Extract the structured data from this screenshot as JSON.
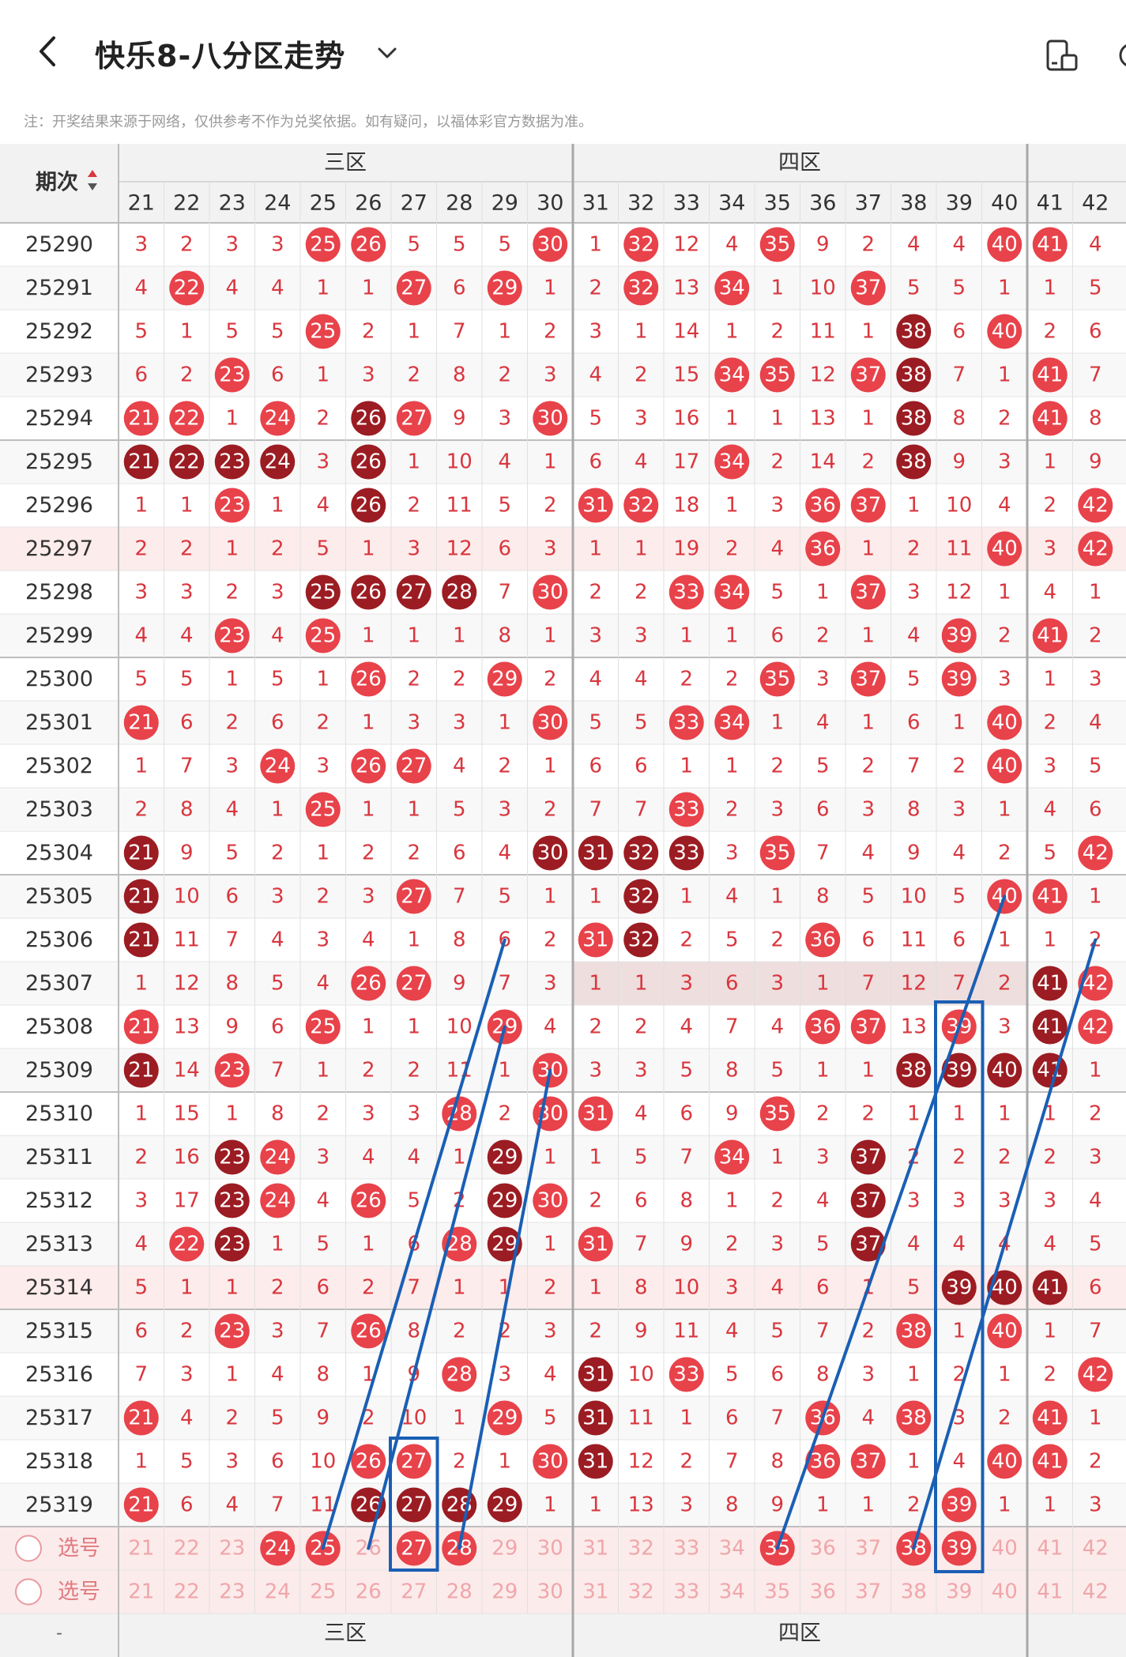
{
  "header": {
    "title": "快乐8-八分区走势",
    "note": "注：开奖结果来源于网络，仅供参考不作为兑奖依据。如有疑问，以福体彩官方数据为准。"
  },
  "table": {
    "period_header": "期次",
    "zones": [
      "三区",
      "四区"
    ],
    "columns": [
      21,
      22,
      23,
      24,
      25,
      26,
      27,
      28,
      29,
      30,
      31,
      32,
      33,
      34,
      35,
      36,
      37,
      38,
      39,
      40,
      41,
      42
    ],
    "select_label": "选号",
    "rows": [
      {
        "period": "25290",
        "cells": [
          3,
          2,
          3,
          3,
          "25r",
          "26r",
          5,
          5,
          5,
          "30r",
          1,
          "32r",
          12,
          4,
          "35r",
          9,
          2,
          4,
          4,
          "40r",
          "41r",
          4
        ]
      },
      {
        "period": "25291",
        "cells": [
          4,
          "22r",
          4,
          4,
          1,
          1,
          "27r",
          6,
          "29r",
          1,
          2,
          "32r",
          13,
          "34r",
          1,
          10,
          "37r",
          5,
          5,
          1,
          1,
          5
        ]
      },
      {
        "period": "25292",
        "cells": [
          5,
          1,
          5,
          5,
          "25r",
          2,
          1,
          7,
          1,
          2,
          3,
          1,
          14,
          1,
          2,
          11,
          1,
          "38d",
          6,
          "40r",
          2,
          6
        ]
      },
      {
        "period": "25293",
        "cells": [
          6,
          2,
          "23r",
          6,
          1,
          3,
          2,
          8,
          2,
          3,
          4,
          2,
          15,
          "34r",
          "35r",
          12,
          "37r",
          "38d",
          7,
          1,
          "41r",
          7
        ]
      },
      {
        "period": "25294",
        "cells": [
          "21r",
          "22r",
          1,
          "24r",
          2,
          "26d",
          "27r",
          9,
          3,
          "30r",
          5,
          3,
          16,
          1,
          1,
          13,
          1,
          "38d",
          8,
          2,
          "41r",
          8
        ]
      },
      {
        "period": "25295",
        "cells": [
          "21d",
          "22d",
          "23d",
          "24d",
          3,
          "26d",
          1,
          10,
          4,
          1,
          6,
          4,
          17,
          "34r",
          2,
          14,
          2,
          "38d",
          9,
          3,
          1,
          9
        ]
      },
      {
        "period": "25296",
        "cells": [
          1,
          1,
          "23r",
          1,
          4,
          "26d",
          2,
          11,
          5,
          2,
          "31r",
          "32r",
          18,
          1,
          3,
          "36r",
          "37r",
          1,
          10,
          4,
          2,
          "42r"
        ]
      },
      {
        "period": "25297",
        "cells": [
          2,
          2,
          1,
          2,
          5,
          1,
          3,
          12,
          6,
          3,
          1,
          1,
          19,
          2,
          4,
          "36r",
          1,
          2,
          11,
          "40r",
          3,
          "42r"
        ]
      },
      {
        "period": "25298",
        "cells": [
          3,
          3,
          2,
          3,
          "25d",
          "26d",
          "27d",
          "28d",
          7,
          "30r",
          2,
          2,
          "33r",
          "34r",
          5,
          1,
          "37r",
          3,
          12,
          1,
          4,
          1
        ]
      },
      {
        "period": "25299",
        "cells": [
          4,
          4,
          "23r",
          4,
          "25r",
          1,
          1,
          1,
          8,
          1,
          3,
          3,
          1,
          1,
          6,
          2,
          1,
          4,
          "39r",
          2,
          "41r",
          2
        ]
      },
      {
        "period": "25300",
        "cells": [
          5,
          5,
          1,
          5,
          1,
          "26r",
          2,
          2,
          "29r",
          2,
          4,
          4,
          2,
          2,
          "35r",
          3,
          "37r",
          5,
          "39r",
          3,
          1,
          3
        ]
      },
      {
        "period": "25301",
        "cells": [
          "21r",
          6,
          2,
          6,
          2,
          1,
          3,
          3,
          1,
          "30r",
          5,
          5,
          "33r",
          "34r",
          1,
          4,
          1,
          6,
          1,
          "40r",
          2,
          4
        ]
      },
      {
        "period": "25302",
        "cells": [
          1,
          7,
          3,
          "24r",
          3,
          "26r",
          "27r",
          4,
          2,
          1,
          6,
          6,
          1,
          1,
          2,
          5,
          2,
          7,
          2,
          "40r",
          3,
          5
        ]
      },
      {
        "period": "25303",
        "cells": [
          2,
          8,
          4,
          1,
          "25r",
          1,
          1,
          5,
          3,
          2,
          7,
          7,
          "33r",
          2,
          3,
          6,
          3,
          8,
          3,
          1,
          4,
          6
        ]
      },
      {
        "period": "25304",
        "cells": [
          "21d",
          9,
          5,
          2,
          1,
          2,
          2,
          6,
          4,
          "30d",
          "31d",
          "32d",
          "33d",
          3,
          "35r",
          7,
          4,
          9,
          4,
          2,
          5,
          "42r"
        ]
      },
      {
        "period": "25305",
        "cells": [
          "21d",
          10,
          6,
          3,
          2,
          3,
          "27r",
          7,
          5,
          1,
          1,
          "32d",
          1,
          4,
          1,
          8,
          5,
          10,
          5,
          "40r",
          "41r",
          1
        ]
      },
      {
        "period": "25306",
        "cells": [
          "21d",
          11,
          7,
          4,
          3,
          4,
          1,
          8,
          6,
          2,
          "31r",
          "32d",
          2,
          5,
          2,
          "36r",
          6,
          11,
          6,
          1,
          1,
          2
        ]
      },
      {
        "period": "25307",
        "cells": [
          1,
          12,
          8,
          5,
          4,
          "26r",
          "27r",
          9,
          7,
          3,
          1,
          1,
          3,
          6,
          3,
          1,
          7,
          12,
          7,
          2,
          "41d",
          "42r"
        ]
      },
      {
        "period": "25308",
        "cells": [
          "21r",
          13,
          9,
          6,
          "25r",
          1,
          1,
          10,
          "29r",
          4,
          2,
          2,
          4,
          7,
          4,
          "36r",
          "37r",
          13,
          "39r",
          3,
          "41d",
          "42r"
        ]
      },
      {
        "period": "25309",
        "cells": [
          "21d",
          14,
          "23r",
          7,
          1,
          2,
          2,
          11,
          1,
          "30r",
          3,
          3,
          5,
          8,
          5,
          1,
          1,
          "38d",
          "39d",
          "40d",
          "41d",
          1
        ]
      },
      {
        "period": "25310",
        "cells": [
          1,
          15,
          1,
          8,
          2,
          3,
          3,
          "28r",
          2,
          "30r",
          "31r",
          4,
          6,
          9,
          "35r",
          2,
          2,
          1,
          1,
          1,
          1,
          2
        ]
      },
      {
        "period": "25311",
        "cells": [
          2,
          16,
          "23d",
          "24r",
          3,
          4,
          4,
          1,
          "29d",
          1,
          1,
          5,
          7,
          "34r",
          1,
          3,
          "37d",
          2,
          2,
          2,
          2,
          3
        ]
      },
      {
        "period": "25312",
        "cells": [
          3,
          17,
          "23d",
          "24r",
          4,
          "26r",
          5,
          2,
          "29d",
          "30r",
          2,
          6,
          8,
          1,
          2,
          4,
          "37d",
          3,
          3,
          3,
          3,
          4
        ]
      },
      {
        "period": "25313",
        "cells": [
          4,
          "22r",
          "23d",
          1,
          5,
          1,
          6,
          "28r",
          "29d",
          1,
          "31r",
          7,
          9,
          2,
          3,
          5,
          "37d",
          4,
          4,
          4,
          4,
          5
        ]
      },
      {
        "period": "25314",
        "cells": [
          5,
          1,
          1,
          2,
          6,
          2,
          7,
          1,
          1,
          2,
          1,
          8,
          10,
          3,
          4,
          6,
          1,
          5,
          "39d",
          "40d",
          "41d",
          6
        ]
      },
      {
        "period": "25315",
        "cells": [
          6,
          2,
          "23r",
          3,
          7,
          "26r",
          8,
          2,
          2,
          3,
          2,
          9,
          11,
          4,
          5,
          7,
          2,
          "38r",
          1,
          "40r",
          1,
          7
        ]
      },
      {
        "period": "25316",
        "cells": [
          7,
          3,
          1,
          4,
          8,
          1,
          9,
          "28r",
          3,
          4,
          "31d",
          10,
          "33r",
          5,
          6,
          8,
          3,
          1,
          2,
          1,
          2,
          "42r"
        ]
      },
      {
        "period": "25317",
        "cells": [
          "21r",
          4,
          2,
          5,
          9,
          2,
          10,
          1,
          "29r",
          5,
          "31d",
          11,
          1,
          6,
          7,
          "36r",
          4,
          "38r",
          3,
          2,
          "41r",
          1
        ]
      },
      {
        "period": "25318",
        "cells": [
          1,
          5,
          3,
          6,
          10,
          "26r",
          "27r",
          2,
          1,
          "30r",
          "31d",
          12,
          2,
          7,
          8,
          "36r",
          "37r",
          1,
          4,
          "40r",
          "41r",
          2
        ]
      },
      {
        "period": "25319",
        "cells": [
          "21r",
          6,
          4,
          7,
          11,
          "26d",
          "27d",
          "28d",
          "29d",
          1,
          1,
          13,
          3,
          8,
          9,
          1,
          1,
          2,
          "39r",
          1,
          1,
          3
        ]
      }
    ],
    "select_rows": [
      {
        "picked": [
          24,
          25,
          27,
          28,
          35,
          38,
          39
        ]
      },
      {
        "picked": []
      }
    ],
    "pink_rows": [
      "25297",
      "25314"
    ],
    "gray_rows": [
      "25307"
    ],
    "colors": {
      "red": "#e8424a",
      "dark": "#9b1c22",
      "numtext": "#d9363e",
      "line": "#1a5fb4",
      "header_bg": "#f2f2f2",
      "pink": "#fdecec",
      "gray_row": "#eedede"
    }
  }
}
